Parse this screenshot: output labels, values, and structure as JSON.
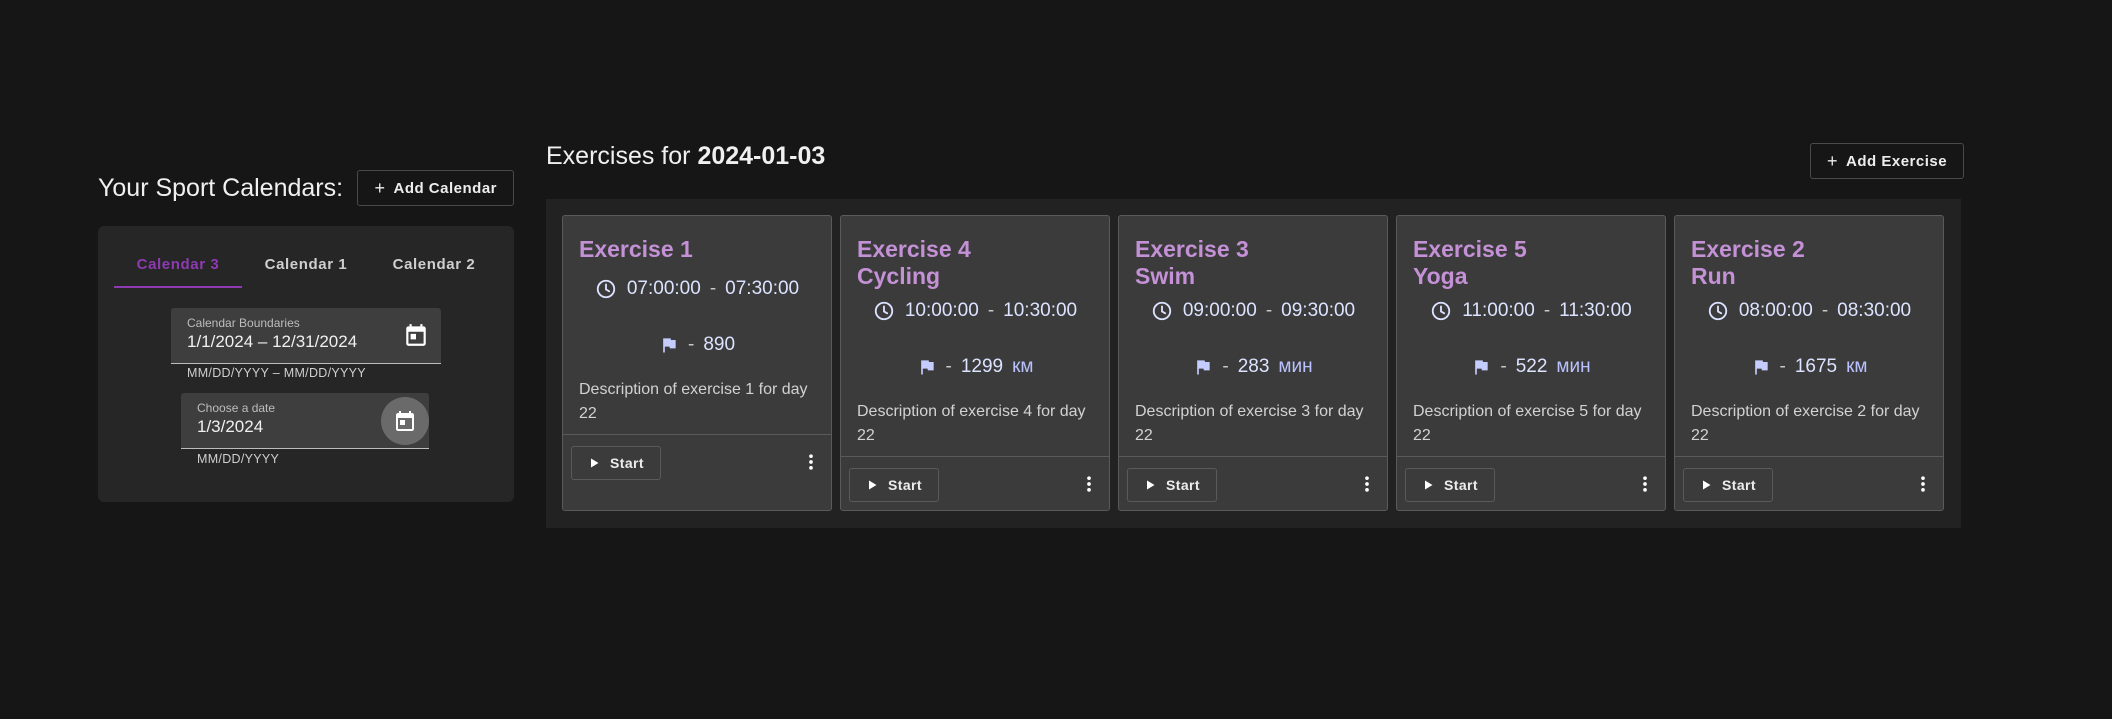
{
  "left": {
    "title": "Your Sport Calendars:",
    "add_calendar_label": "Add Calendar",
    "tabs": [
      {
        "label": "Calendar 3",
        "active": true
      },
      {
        "label": "Calendar 1",
        "active": false
      },
      {
        "label": "Calendar 2",
        "active": false
      }
    ],
    "boundaries": {
      "label": "Calendar Boundaries",
      "value": "1/1/2024 – 12/31/2024",
      "hint": "MM/DD/YYYY – MM/DD/YYYY"
    },
    "date": {
      "label": "Choose a date",
      "value": "1/3/2024",
      "hint": "MM/DD/YYYY"
    }
  },
  "right": {
    "title_prefix": "Exercises for",
    "title_date": "2024-01-03",
    "add_exercise_label": "Add Exercise",
    "exercises": [
      {
        "title1": "Exercise 1",
        "title2": "",
        "start": "07:00:00",
        "end": "07:30:00",
        "sep": "-",
        "value": "890",
        "unit": "",
        "description": "Description of exercise 1 for day 22",
        "start_label": "Start"
      },
      {
        "title1": "Exercise 4",
        "title2": "Cycling",
        "start": "10:00:00",
        "end": "10:30:00",
        "sep": "-",
        "value": "1299",
        "unit": "км",
        "description": "Description of exercise 4 for day 22",
        "start_label": "Start"
      },
      {
        "title1": "Exercise 3",
        "title2": "Swim",
        "start": "09:00:00",
        "end": "09:30:00",
        "sep": "-",
        "value": "283",
        "unit": "мин",
        "description": "Description of exercise 3 for day 22",
        "start_label": "Start"
      },
      {
        "title1": "Exercise 5",
        "title2": "Yoga",
        "start": "11:00:00",
        "end": "11:30:00",
        "sep": "-",
        "value": "522",
        "unit": "мин",
        "description": "Description of exercise 5 for day 22",
        "start_label": "Start"
      },
      {
        "title1": "Exercise 2",
        "title2": "Run",
        "start": "08:00:00",
        "end": "08:30:00",
        "sep": "-",
        "value": "1675",
        "unit": "км",
        "description": "Description of exercise 2 for day 22",
        "start_label": "Start"
      }
    ]
  },
  "icons": {
    "add": "plus-icon",
    "calendar": "calendar-icon",
    "clock": "clock-icon",
    "flag": "flag-icon",
    "play": "play-icon",
    "more": "more-vert-icon"
  },
  "colors": {
    "accent": "#8e3ab3",
    "card_title": "#c491d6",
    "background": "#161616",
    "panel": "#262626"
  }
}
